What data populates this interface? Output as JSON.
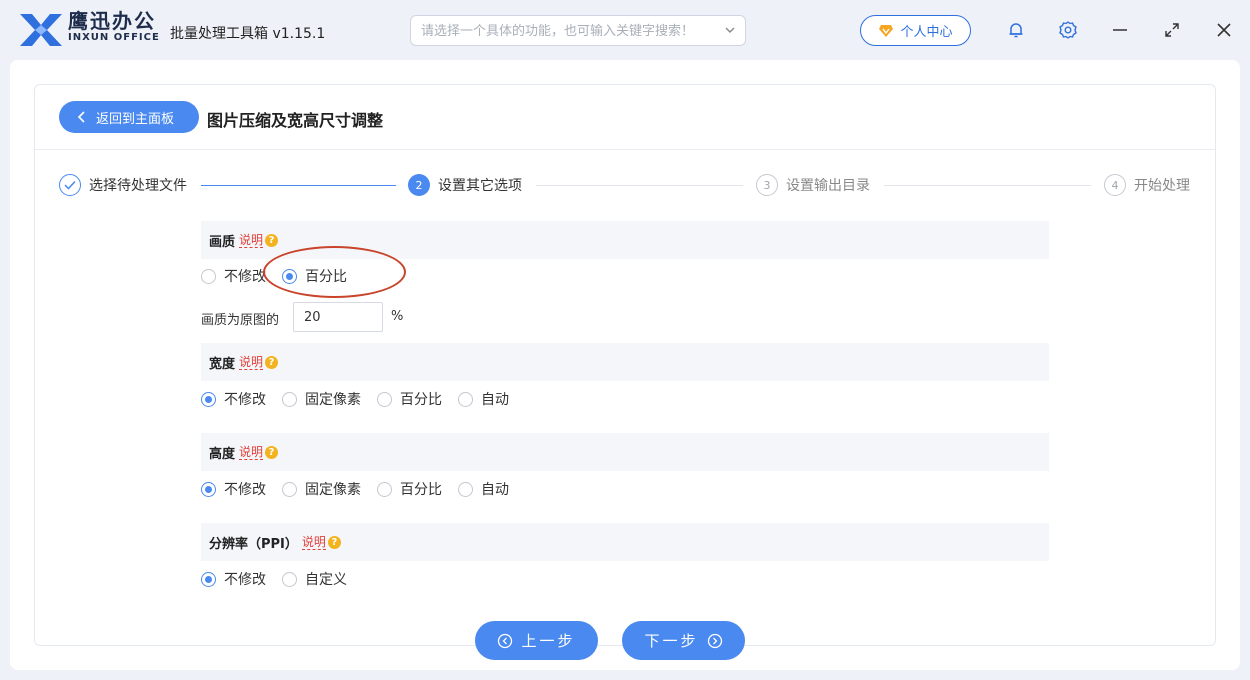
{
  "app": {
    "brand_cn": "鹰迅办公",
    "brand_en": "INXUN OFFICE",
    "title": "批量处理工具箱 v1.15.1",
    "search_placeholder": "请选择一个具体的功能，也可输入关键字搜索！",
    "user_center": "个人中心",
    "accent": "#4a89f0"
  },
  "page": {
    "back_label": "返回到主面板",
    "title": "图片压缩及宽高尺寸调整"
  },
  "steps": [
    {
      "num": "✓",
      "label": "选择待处理文件",
      "state": "done"
    },
    {
      "num": "2",
      "label": "设置其它选项",
      "state": "active"
    },
    {
      "num": "3",
      "label": "设置输出目录",
      "state": "todo"
    },
    {
      "num": "4",
      "label": "开始处理",
      "state": "todo"
    }
  ],
  "explain_label": "说明",
  "quality": {
    "heading": "画质",
    "options": [
      "不修改",
      "百分比"
    ],
    "selected": 1,
    "field_label": "画质为原图的",
    "value": "20",
    "unit": "%"
  },
  "width": {
    "heading": "宽度",
    "options": [
      "不修改",
      "固定像素",
      "百分比",
      "自动"
    ],
    "selected": 0
  },
  "height": {
    "heading": "高度",
    "options": [
      "不修改",
      "固定像素",
      "百分比",
      "自动"
    ],
    "selected": 0
  },
  "ppi": {
    "heading": "分辨率（PPI）",
    "options": [
      "不修改",
      "自定义"
    ],
    "selected": 0
  },
  "nav": {
    "prev": "上一步",
    "next": "下一步"
  }
}
